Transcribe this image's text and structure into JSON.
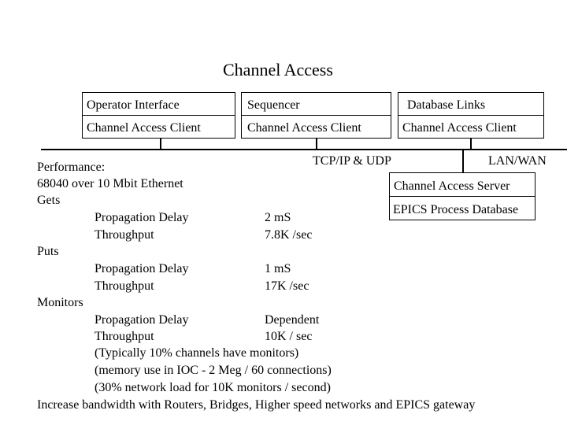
{
  "title": "Channel Access",
  "clients": [
    {
      "top": "Operator Interface",
      "bottom": "Channel Access Client"
    },
    {
      "top": "Sequencer",
      "bottom": "Channel Access Client"
    },
    {
      "top": "Database Links",
      "bottom": "Channel Access Client"
    }
  ],
  "network": {
    "protocol": "TCP/IP & UDP",
    "scope": "LAN/WAN"
  },
  "server": {
    "top": "Channel Access Server",
    "bottom": "EPICS Process Database"
  },
  "performance": {
    "heading": "Performance:",
    "platform": "68040 over 10 Mbit Ethernet",
    "gets": {
      "label": "Gets",
      "rows": [
        {
          "metric": "Propagation Delay",
          "value": "2  mS"
        },
        {
          "metric": "Throughput",
          "value": "7.8K /sec"
        }
      ]
    },
    "puts": {
      "label": "Puts",
      "rows": [
        {
          "metric": "Propagation Delay",
          "value": "1 mS"
        },
        {
          "metric": "Throughput",
          "value": "17K /sec"
        }
      ]
    },
    "monitors": {
      "label": "Monitors",
      "rows": [
        {
          "metric": "Propagation Delay",
          "value": "Dependent"
        },
        {
          "metric": "Throughput",
          "value": "10K / sec"
        }
      ],
      "notes": [
        "(Typically 10% channels have monitors)",
        "(memory use in IOC - 2 Meg / 60 connections)",
        "(30% network load for 10K monitors / second)"
      ]
    },
    "footer": "Increase bandwidth with Routers, Bridges, Higher speed networks and EPICS gateway"
  }
}
